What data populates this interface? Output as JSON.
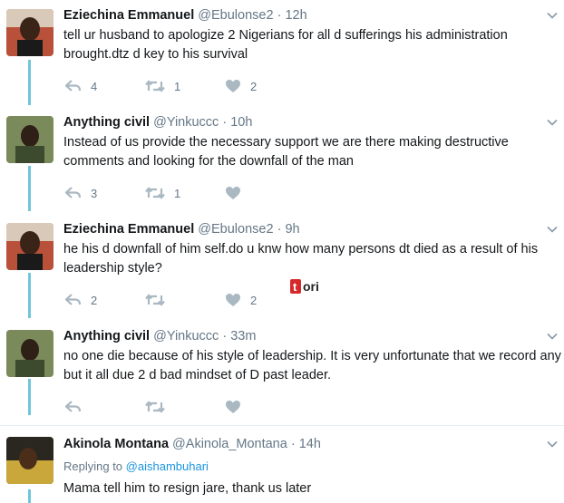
{
  "tweets": [
    {
      "name": "Eziechina Emmanuel",
      "handle": "@Ebulonse2",
      "dot": "·",
      "time": "12h",
      "text": "tell ur husband to apologize 2 Nigerians for all d sufferings his administration brought.dtz d key to his survival",
      "reply_count": "4",
      "retweet_count": "1",
      "like_count": "2"
    },
    {
      "name": "Anything civil",
      "handle": "@Yinkuccc",
      "dot": "·",
      "time": "10h",
      "text": "Instead of us provide the necessary support we are there making destructive comments and looking for the downfall of the man",
      "reply_count": "3",
      "retweet_count": "1",
      "like_count": ""
    },
    {
      "name": "Eziechina Emmanuel",
      "handle": "@Ebulonse2",
      "dot": "·",
      "time": "9h",
      "text": "he his d downfall of him self.do u knw how many persons dt died as a result of his leadership style?",
      "reply_count": "2",
      "retweet_count": "",
      "like_count": "2"
    },
    {
      "name": "Anything civil",
      "handle": "@Yinkuccc",
      "dot": "·",
      "time": "33m",
      "text": "no one die because of his style of leadership. It is very unfortunate that we record any but it all due 2 d bad mindset of D past leader.",
      "reply_count": "",
      "retweet_count": "",
      "like_count": ""
    },
    {
      "name": "Akinola Montana",
      "handle": "@Akinola_Montana",
      "dot": "·",
      "time": "14h",
      "replying_prefix": "Replying to",
      "replying_mention": "@aishambuhari",
      "text": "Mama tell him to resign jare, thank us later"
    }
  ],
  "watermark": "tori",
  "colors": {
    "thread_line": "#70c5d9",
    "mention": "#1b95e0",
    "muted": "#657786",
    "icon": "#aab8c2"
  },
  "icons": [
    "reply-icon",
    "retweet-icon",
    "like-icon",
    "caret-down-icon"
  ]
}
